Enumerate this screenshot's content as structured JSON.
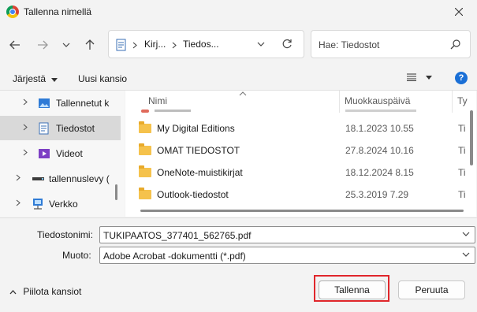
{
  "window": {
    "title": "Tallenna nimellä"
  },
  "address_bar": {
    "crumbs": [
      "Kirj...",
      "Tiedos..."
    ]
  },
  "search": {
    "placeholder": "Hae: Tiedostot"
  },
  "toolbar": {
    "organize_label": "Järjestä",
    "new_folder_label": "Uusi kansio",
    "help_label": "?"
  },
  "navigation_pane": {
    "items": [
      {
        "label": "Tallennetut k",
        "icon": "pictures-icon"
      },
      {
        "label": "Tiedostot",
        "icon": "documents-icon",
        "selected": true
      },
      {
        "label": "Videot",
        "icon": "videos-icon"
      },
      {
        "label": "tallennuslevy (",
        "icon": "drive-icon"
      },
      {
        "label": "Verkko",
        "icon": "network-icon"
      }
    ]
  },
  "file_list": {
    "columns": [
      "Nimi",
      "Muokkauspäivä",
      "Ty"
    ],
    "rows": [
      {
        "name": "My Digital Editions",
        "modified": "18.1.2023 10.55",
        "type": "Ti"
      },
      {
        "name": "OMAT TIEDOSTOT",
        "modified": "27.8.2024 10.16",
        "type": "Ti"
      },
      {
        "name": "OneNote-muistikirjat",
        "modified": "18.12.2024 8.15",
        "type": "Ti"
      },
      {
        "name": "Outlook-tiedostot",
        "modified": "25.3.2019 7.29",
        "type": "Ti"
      }
    ]
  },
  "form": {
    "filename_label": "Tiedostonimi:",
    "filename_value": "TUKIPAATOS_377401_562765.pdf",
    "format_label": "Muoto:",
    "format_value": "Adobe Acrobat -dokumentti (*.pdf)"
  },
  "footer": {
    "hide_folders_label": "Piilota kansiot",
    "save_label": "Tallenna",
    "cancel_label": "Peruuta"
  },
  "colors": {
    "highlight": "#e0262b",
    "selected_row": "#d9d9d9",
    "folder": "#f5c24c",
    "help_button": "#1a6fd6"
  }
}
